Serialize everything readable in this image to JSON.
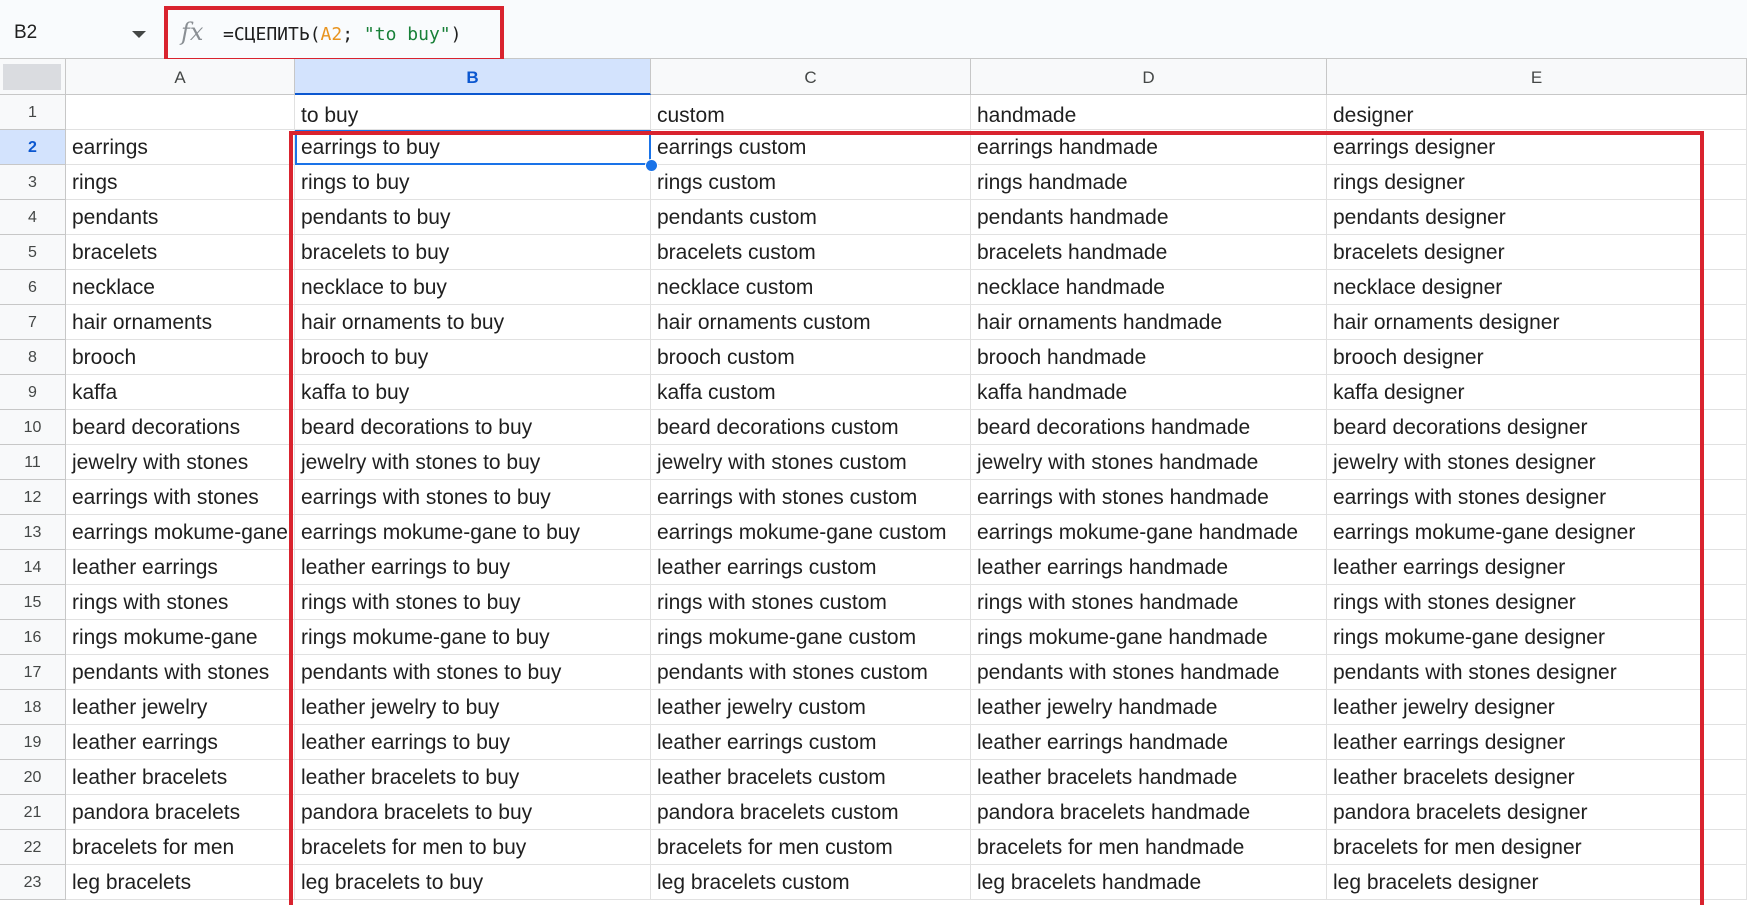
{
  "formula_bar": {
    "name_box": "B2",
    "fx_label": "fx",
    "formula_prefix": "=СЦЕПИТЬ(",
    "formula_ref": "A2",
    "formula_sep": "; ",
    "formula_str": "\"to buy\"",
    "formula_suffix": ")"
  },
  "columns": [
    "A",
    "B",
    "C",
    "D",
    "E"
  ],
  "selected_column": "B",
  "selected_row": "2",
  "colors": {
    "highlight": "#d9232e",
    "selection": "#1a73e8",
    "header_selected": "#d3e3fd"
  },
  "rows": [
    {
      "n": "1",
      "cells": [
        "",
        "to buy",
        "custom",
        "handmade",
        "designer"
      ]
    },
    {
      "n": "2",
      "cells": [
        "earrings",
        "earrings to buy",
        "earrings custom",
        "earrings handmade",
        "earrings designer"
      ]
    },
    {
      "n": "3",
      "cells": [
        "rings",
        "rings to buy",
        "rings custom",
        "rings handmade",
        "rings designer"
      ]
    },
    {
      "n": "4",
      "cells": [
        "pendants",
        "pendants to buy",
        "pendants custom",
        "pendants handmade",
        "pendants designer"
      ]
    },
    {
      "n": "5",
      "cells": [
        "bracelets",
        "bracelets to buy",
        "bracelets custom",
        "bracelets handmade",
        "bracelets designer"
      ]
    },
    {
      "n": "6",
      "cells": [
        "necklace",
        "necklace to buy",
        "necklace custom",
        "necklace handmade",
        "necklace designer"
      ]
    },
    {
      "n": "7",
      "cells": [
        "hair ornaments",
        "hair ornaments to buy",
        "hair ornaments custom",
        "hair ornaments handmade",
        "hair ornaments designer"
      ]
    },
    {
      "n": "8",
      "cells": [
        "brooch",
        "brooch to buy",
        "brooch custom",
        "brooch handmade",
        "brooch designer"
      ]
    },
    {
      "n": "9",
      "cells": [
        "kaffa",
        "kaffa to buy",
        "kaffa custom",
        "kaffa handmade",
        "kaffa designer"
      ]
    },
    {
      "n": "10",
      "cells": [
        "beard decorations",
        "beard decorations to buy",
        "beard decorations custom",
        "beard decorations handmade",
        "beard decorations designer"
      ]
    },
    {
      "n": "11",
      "cells": [
        "jewelry with stones",
        "jewelry with stones to buy",
        "jewelry with stones custom",
        "jewelry with stones handmade",
        "jewelry with stones designer"
      ]
    },
    {
      "n": "12",
      "cells": [
        "earrings with stones",
        "earrings with stones to buy",
        "earrings with stones custom",
        "earrings with stones handmade",
        "earrings with stones designer"
      ]
    },
    {
      "n": "13",
      "cells": [
        "earrings mokume-gane",
        "earrings mokume-gane to buy",
        "earrings mokume-gane custom",
        "earrings mokume-gane handmade",
        "earrings mokume-gane designer"
      ]
    },
    {
      "n": "14",
      "cells": [
        "leather earrings",
        "leather earrings to buy",
        "leather earrings custom",
        "leather earrings handmade",
        "leather earrings designer"
      ]
    },
    {
      "n": "15",
      "cells": [
        "rings with stones",
        "rings with stones to buy",
        "rings with stones custom",
        "rings with stones handmade",
        "rings with stones designer"
      ]
    },
    {
      "n": "16",
      "cells": [
        "rings mokume-gane",
        "rings mokume-gane to buy",
        "rings mokume-gane custom",
        "rings mokume-gane handmade",
        "rings mokume-gane designer"
      ]
    },
    {
      "n": "17",
      "cells": [
        "pendants with stones",
        "pendants with stones to buy",
        "pendants with stones custom",
        "pendants with stones handmade",
        "pendants with stones designer"
      ]
    },
    {
      "n": "18",
      "cells": [
        "leather jewelry",
        "leather jewelry to buy",
        "leather jewelry custom",
        "leather jewelry handmade",
        "leather jewelry designer"
      ]
    },
    {
      "n": "19",
      "cells": [
        "leather earrings",
        "leather earrings to buy",
        "leather earrings custom",
        "leather earrings handmade",
        "leather earrings designer"
      ]
    },
    {
      "n": "20",
      "cells": [
        "leather bracelets",
        "leather bracelets to buy",
        "leather bracelets custom",
        "leather bracelets handmade",
        "leather bracelets designer"
      ]
    },
    {
      "n": "21",
      "cells": [
        "pandora bracelets",
        "pandora bracelets to buy",
        "pandora bracelets custom",
        "pandora bracelets handmade",
        "pandora bracelets designer"
      ]
    },
    {
      "n": "22",
      "cells": [
        "bracelets for men",
        "bracelets for men to buy",
        "bracelets for men custom",
        "bracelets for men handmade",
        "bracelets for men designer"
      ]
    },
    {
      "n": "23",
      "cells": [
        "leg bracelets",
        "leg bracelets to buy",
        "leg bracelets custom",
        "leg bracelets handmade",
        "leg bracelets designer"
      ]
    }
  ]
}
